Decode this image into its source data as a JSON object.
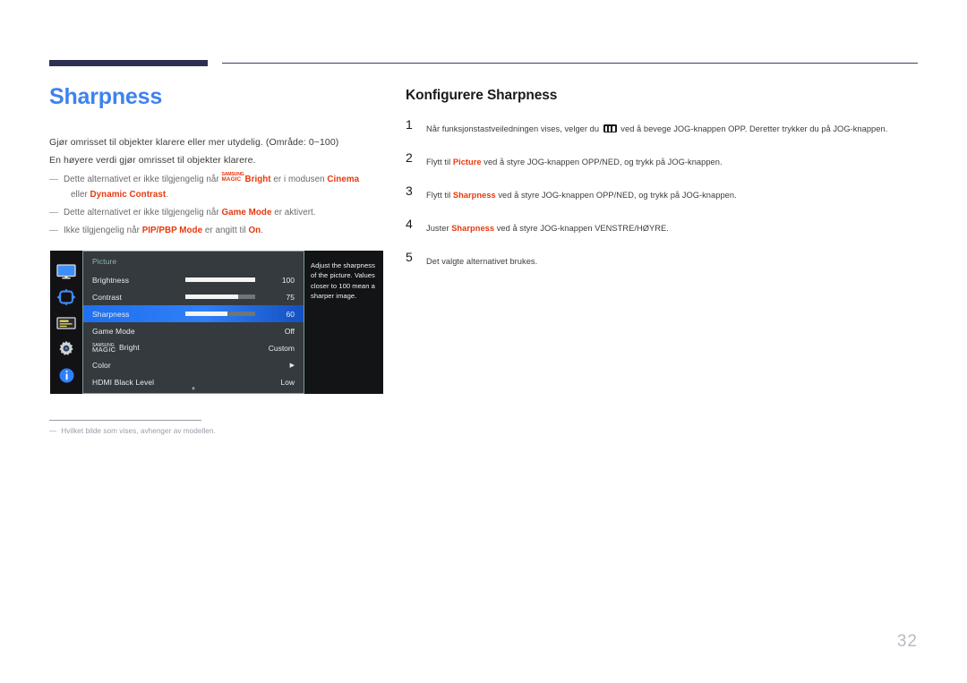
{
  "colors": {
    "title_blue": "#3e82f0",
    "keyword_red": "#e8380d",
    "rule_navy": "#2e3053",
    "osd_highlight": "#2f7ff8",
    "osd_panel": "#343a3e",
    "osd_rail": "#121214",
    "osd_desc_bg": "#131416",
    "page_number": "#b9b9c4"
  },
  "left": {
    "title": "Sharpness",
    "body": [
      "Gjør omrisset til objekter klarere eller mer utydelig. (Område: 0~100)",
      "En høyere verdi gjør omrisset til objekter klarere."
    ],
    "notes": [
      {
        "dash": "―",
        "pre": "Dette alternativet er ikke tilgjengelig når ",
        "magic_line1": "SAMSUNG",
        "magic_line2": "MAGIC",
        "kw1": "Bright",
        "mid": " er i modusen ",
        "kw2": "Cinema",
        "cont_pre": "eller ",
        "cont_kw": "Dynamic Contrast",
        "cont_post": "."
      },
      {
        "dash": "―",
        "pre": "Dette alternativet er ikke tilgjengelig når ",
        "kw1": "Game Mode",
        "post": " er aktivert."
      },
      {
        "dash": "―",
        "pre": "Ikke tilgjengelig når ",
        "kw1": "PIP/PBP Mode",
        "mid": " er angitt til ",
        "kw2": "On",
        "post": "."
      }
    ],
    "footnote": {
      "dash": "―",
      "text": "Hvilket bilde som vises, avhenger av modellen."
    }
  },
  "osd": {
    "rail_icons": [
      "monitor-icon",
      "pip-arrows-icon",
      "onscreen-display-icon",
      "system-gear-icon",
      "information-icon"
    ],
    "menu_title": "Picture",
    "rows": [
      {
        "label": "Brightness",
        "type": "slider",
        "value": "100",
        "fill_pct": 100,
        "selected": false
      },
      {
        "label": "Contrast",
        "type": "slider",
        "value": "75",
        "fill_pct": 75,
        "selected": false
      },
      {
        "label": "Sharpness",
        "type": "slider",
        "value": "60",
        "fill_pct": 60,
        "selected": true
      },
      {
        "label": "Game Mode",
        "type": "value",
        "value": "Off",
        "selected": false
      },
      {
        "label": "MAGICBright",
        "magic_line1": "SAMSUNG",
        "magic_line2": "MAGIC",
        "magic_suffix": "Bright",
        "type": "magic",
        "value": "Custom",
        "selected": false
      },
      {
        "label": "Color",
        "type": "submenu",
        "value": "▶",
        "selected": false
      },
      {
        "label": "HDMI Black Level",
        "type": "value",
        "value": "Low",
        "selected": false
      }
    ],
    "scroll_caret": "▼",
    "description": "Adjust the sharpness of the picture. Values closer to 100 mean a sharper image."
  },
  "right": {
    "title": "Konfigurere Sharpness",
    "steps": [
      {
        "num": "1",
        "pre": "Når funksjonstastveiledningen vises, velger du ",
        "icon": "jog-menu-icon",
        "post": " ved å bevege JOG-knappen OPP. Deretter trykker du på JOG-knappen."
      },
      {
        "num": "2",
        "pre": "Flytt til ",
        "kw": "Picture",
        "post": " ved å styre JOG-knappen OPP/NED, og trykk på JOG-knappen."
      },
      {
        "num": "3",
        "pre": "Flytt til ",
        "kw": "Sharpness",
        "post": " ved å styre JOG-knappen OPP/NED, og trykk på JOG-knappen."
      },
      {
        "num": "4",
        "pre": "Juster ",
        "kw": "Sharpness",
        "post": " ved å styre JOG-knappen VENSTRE/HØYRE."
      },
      {
        "num": "5",
        "pre": "Det valgte alternativet brukes.",
        "kw": "",
        "post": ""
      }
    ]
  },
  "page_number": "32"
}
